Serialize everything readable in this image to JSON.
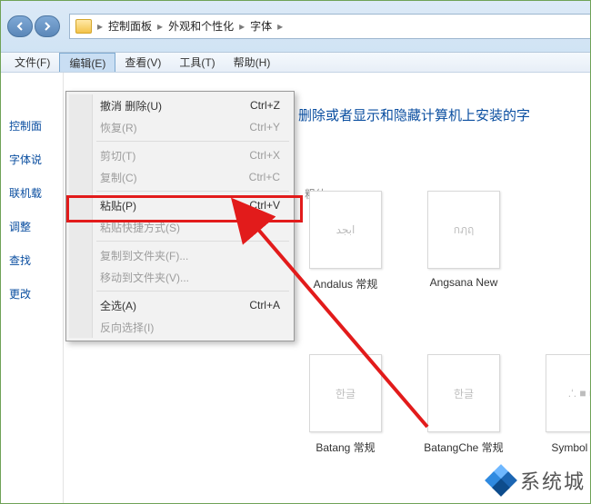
{
  "titlebar": {
    "crumbs": [
      "控制面板",
      "外观和个性化",
      "字体"
    ]
  },
  "menubar": {
    "items": [
      {
        "label": "文件(F)"
      },
      {
        "label": "编辑(E)",
        "open": true
      },
      {
        "label": "查看(V)"
      },
      {
        "label": "工具(T)"
      },
      {
        "label": "帮助(H)"
      }
    ]
  },
  "dropdown": {
    "groups": [
      [
        {
          "label": "撤消 删除(U)",
          "shortcut": "Ctrl+Z",
          "enabled": true
        },
        {
          "label": "恢复(R)",
          "shortcut": "Ctrl+Y",
          "enabled": false
        }
      ],
      [
        {
          "label": "剪切(T)",
          "shortcut": "Ctrl+X",
          "enabled": false
        },
        {
          "label": "复制(C)",
          "shortcut": "Ctrl+C",
          "enabled": false
        }
      ],
      [
        {
          "label": "粘贴(P)",
          "shortcut": "Ctrl+V",
          "enabled": true,
          "highlighted": true
        },
        {
          "label": "粘贴快捷方式(S)",
          "shortcut": "",
          "enabled": false
        }
      ],
      [
        {
          "label": "复制到文件夹(F)...",
          "shortcut": "",
          "enabled": false
        },
        {
          "label": "移动到文件夹(V)...",
          "shortcut": "",
          "enabled": false
        }
      ],
      [
        {
          "label": "全选(A)",
          "shortcut": "Ctrl+A",
          "enabled": true
        },
        {
          "label": "反向选择(I)",
          "shortcut": "",
          "enabled": false
        }
      ]
    ]
  },
  "sidebar": {
    "items": [
      "控制面",
      "字体说",
      "联机载",
      "调整",
      "查找",
      "更改"
    ]
  },
  "main": {
    "heading_fragment": "删除或者显示和隐藏计算机上安装的字",
    "row0_labels": [
      "粗体"
    ],
    "fonts_row1": [
      {
        "preview": "ابجد",
        "label": "Andalus 常规"
      },
      {
        "preview": "กฦฤ",
        "label": "Angsana New"
      }
    ],
    "fonts_row2": [
      {
        "preview": "한글",
        "label": "Batang 常规"
      },
      {
        "preview": "한글",
        "label": "BatangChe 常规"
      },
      {
        "preview": ".‘. ■ ■",
        "label": "Symbol 字符"
      }
    ]
  },
  "watermark": {
    "text": "系统城"
  },
  "colors": {
    "annotation_red": "#e21b1b",
    "link_blue": "#0a4ea0"
  }
}
